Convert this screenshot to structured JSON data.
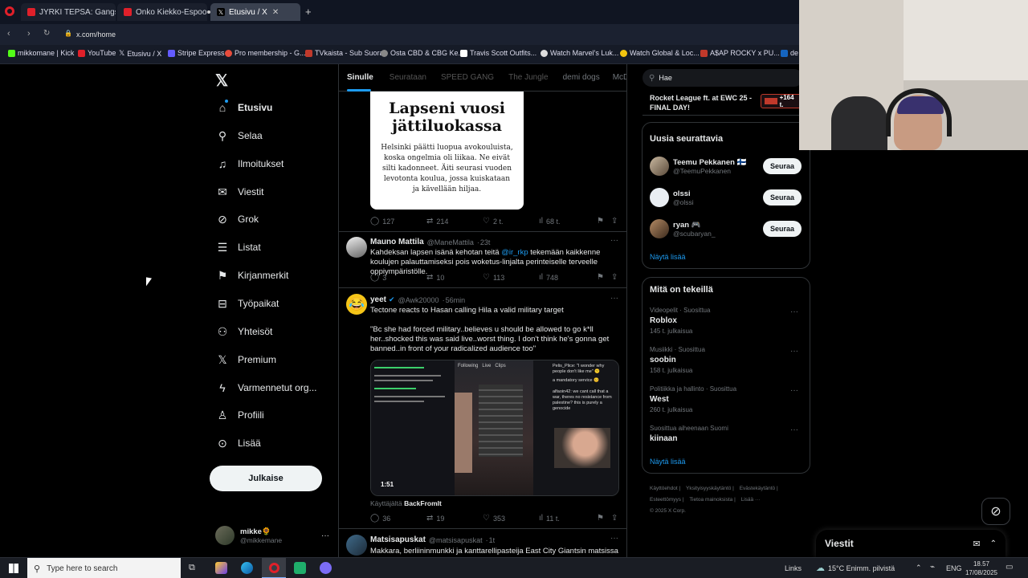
{
  "browser": {
    "tabs": [
      {
        "label": "JYRKI TEPSA: Gangsterielä"
      },
      {
        "label": "Onko Kiekko-Espoon rom"
      },
      {
        "label": "Etusivu / X"
      }
    ],
    "url": "x.com/home",
    "bookmarks": [
      {
        "label": "mikkomane | Kick"
      },
      {
        "label": "YouTube"
      },
      {
        "label": "Etusivu / X"
      },
      {
        "label": "Stripe Express"
      },
      {
        "label": "Pro membership - G..."
      },
      {
        "label": "TVkaista - Sub Suora"
      },
      {
        "label": "Osta CBD & CBG Ke..."
      },
      {
        "label": "Travis Scott Outfits..."
      },
      {
        "label": "Watch Marvel's Luk..."
      },
      {
        "label": "Watch Global & Loc..."
      },
      {
        "label": "A$AP ROCKY x PU..."
      },
      {
        "label": "de"
      }
    ]
  },
  "sidebar": {
    "items": [
      {
        "label": "Etusivu"
      },
      {
        "label": "Selaa"
      },
      {
        "label": "Ilmoitukset"
      },
      {
        "label": "Viestit"
      },
      {
        "label": "Grok"
      },
      {
        "label": "Listat"
      },
      {
        "label": "Kirjanmerkit"
      },
      {
        "label": "Työpaikat"
      },
      {
        "label": "Yhteisöt"
      },
      {
        "label": "Premium"
      },
      {
        "label": "Varmennetut org..."
      },
      {
        "label": "Profiili"
      },
      {
        "label": "Lisää"
      }
    ],
    "post_label": "Julkaise",
    "account": {
      "name": "mikke🌻",
      "handle": "@mikkemane"
    }
  },
  "feed": {
    "tabs": [
      "Sinulle",
      "Seurataan",
      "SPEED GANG",
      "The Jungle",
      "demi dogs",
      "McDonal"
    ],
    "post1": {
      "image_title": "Lapseni vuosi jättiluokassa",
      "image_body": "Helsinki päätti luopua avokouluista, koska ongelmia oli liikaa. Ne eivät silti kadonneet. Äiti seurasi vuoden levotonta koulua, jossa kuiskataan ja kävellään hiljaa.",
      "replies": "127",
      "reposts": "214",
      "likes": "2 t.",
      "views": "68 t."
    },
    "post2": {
      "name": "Mauno Mattila",
      "handle": "@ManeMattila",
      "time": "23t",
      "text_a": "Kahdeksan lapsen isänä kehotan teitä ",
      "mention": "@ir_rkp",
      "text_b": " tekemään kaikkenne koulujen palauttamiseksi pois woketus-linjalta perinteiselle terveelle oppiympäristölle.",
      "replies": "3",
      "reposts": "10",
      "likes": "113",
      "views": "748"
    },
    "post3": {
      "name": "yeet",
      "handle": "@Awk20000",
      "time": "56min",
      "line1": "Tectone reacts to Hasan calling Hila a valid military target",
      "quote": "\"Bc she had forced military..believes u should be allowed to go k*ll her..shocked this was said live..worst thing. I don't think he's gonna get banned..in front of your radicalized audience too\"",
      "video_time": "1:51",
      "stream_tabs": "Following   Live   Clips",
      "comment_top": "Pelis_Plice: \"I wonder why people don't like me\" 😕",
      "comment_mid": "a mandatory service 😊",
      "comment_bot": "alfaoin42: we cant call that a war, theres no resistance from palestine? this is purely a genocide",
      "credit_prefix": "Käyttäjältä ",
      "credit_user": "BackFromIt",
      "replies": "36",
      "reposts": "19",
      "likes": "353",
      "views": "11 t."
    },
    "post4": {
      "name": "Matsisapuskat",
      "handle": "@matsisapuskat",
      "time": "1t",
      "text": "Makkara, berliininmunkki ja kanttarellipasteija East City Giantsin matsissa"
    }
  },
  "right": {
    "search_placeholder": "Hae",
    "trend_banner": "Rocket League ft. at EWC 25 - FINAL DAY!",
    "trend_badge": "+164 t.",
    "who_title": "Uusia seurattavia",
    "who": [
      {
        "name": "Teemu Pekkanen 🇫🇮",
        "handle": "@TeemuPekkanen",
        "btn": "Seuraa"
      },
      {
        "name": "olssi",
        "handle": "@olssi",
        "btn": "Seuraa"
      },
      {
        "name": "ryan 🎮",
        "handle": "@scubaryan_",
        "btn": "Seuraa"
      }
    ],
    "who_more": "Näytä lisää",
    "trends_title": "Mitä on tekeillä",
    "trends": [
      {
        "meta": "Videopelit · Suosittua",
        "title": "Roblox",
        "count": "145 t. julkaisua"
      },
      {
        "meta": "Musiikki · Suosittua",
        "title": "soobin",
        "count": "158 t. julkaisua"
      },
      {
        "meta": "Politiikka ja hallinto · Suosittua",
        "title": "West",
        "count": "260 t. julkaisua"
      },
      {
        "meta": "Suosittua aiheenaan Suomi",
        "title": "kiinaan",
        "count": ""
      }
    ],
    "trends_more": "Näytä lisää",
    "footer": [
      "Käyttöehdot",
      "Yksityisyyskäytäntö",
      "Evästekäytäntö",
      "Esteettömyys",
      "Tietoa mainoksista",
      "Lisää ···",
      "© 2025 X Corp."
    ],
    "messages_label": "Viestit"
  },
  "taskbar": {
    "search_placeholder": "Type here to search",
    "links": "Links",
    "weather": "15°C  Enimm. pilvistä",
    "lang": "ENG",
    "time": "18.57",
    "date": "17/08/2025"
  },
  "colors": {
    "accent": "#1d9bf0",
    "bg": "#000000",
    "text": "#e7e9ea",
    "muted": "#71767b"
  }
}
